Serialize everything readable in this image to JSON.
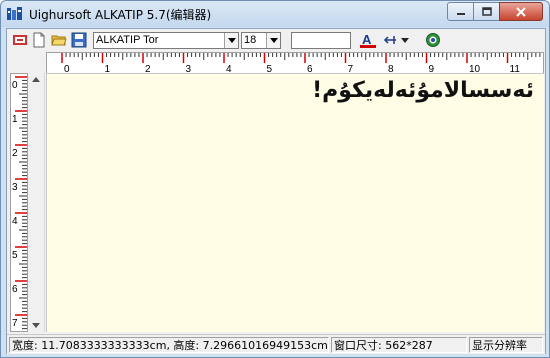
{
  "window": {
    "title": "Uighursoft ALKATIP 5.7(编辑器)"
  },
  "toolbar": {
    "font_name": "ALKATIP Tor",
    "font_size": "18",
    "color_letter": "A"
  },
  "ruler": {
    "h_labels": [
      "0",
      "1",
      "2",
      "3",
      "4",
      "5",
      "6",
      "7",
      "8",
      "9",
      "10",
      "11"
    ],
    "v_labels": [
      "0",
      "1",
      "2",
      "3",
      "4",
      "5",
      "6",
      "7"
    ]
  },
  "editor": {
    "text": "ئەسسالامۇئەلەيكۇم!"
  },
  "status": {
    "size_info": "宽度: 11.7083333333333cm, 高度: 7.29661016949153cm",
    "window_size": "窗口尺寸: 562*287",
    "display_mode": "显示分辨率"
  },
  "colors": {
    "accent_red": "#d40000",
    "editor_bg": "#fffde5",
    "title_bar": "#cfe0f1"
  },
  "icons": [
    "app-icon",
    "new-file-icon",
    "open-folder-icon",
    "save-icon",
    "text-color-icon",
    "text-direction-icon",
    "dropdown-arrow-icon",
    "web-icon",
    "minimize-icon",
    "maximize-icon",
    "close-icon",
    "scroll-up-icon",
    "scroll-down-icon"
  ]
}
